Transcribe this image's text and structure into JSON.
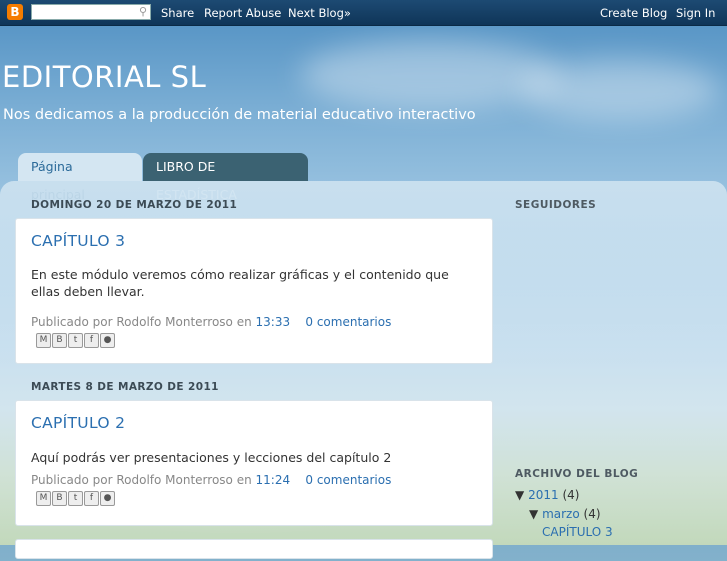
{
  "navbar": {
    "logo": "B",
    "search_placeholder": "",
    "links": {
      "share": "Share",
      "report_abuse": "Report Abuse",
      "next_blog": "Next Blog»",
      "create_blog": "Create Blog",
      "sign_in": "Sign In"
    }
  },
  "header": {
    "title": "EDITORIAL SL",
    "description": "Nos dedicamos a la producción de material educativo interactivo"
  },
  "tabs": [
    {
      "label": "Página principal"
    },
    {
      "label": "LIBRO DE ESTADÍSTICA"
    }
  ],
  "posts": [
    {
      "date": "DOMINGO 20 DE MARZO DE 2011",
      "title": "CAPÍTULO 3",
      "body": "En este módulo veremos cómo realizar gráficas y el contenido que ellas deben llevar.",
      "footer_prefix": "Publicado por Rodolfo Monterroso en",
      "time": "13:33",
      "comments": "0 comentarios"
    },
    {
      "date": "MARTES 8 DE MARZO DE 2011",
      "title": "CAPÍTULO 2",
      "body": "Aquí podrás ver presentaciones y lecciones del capítulo 2",
      "footer_prefix": "Publicado por Rodolfo Monterroso en",
      "time": "11:24",
      "comments": "0 comentarios"
    }
  ],
  "share_icons": [
    "email-icon",
    "blogthis-icon",
    "twitter-icon",
    "facebook-icon",
    "buzz-icon"
  ],
  "sidebar": {
    "followers_title": "SEGUIDORES",
    "archive_title": "ARCHIVO DEL BLOG",
    "archive": {
      "year": "2011",
      "year_count": "(4)",
      "month": "marzo",
      "month_count": "(4)",
      "post": "CAPÍTULO 3"
    }
  },
  "colors": {
    "accent": "#2b6fb0",
    "navbar": "#0f3558",
    "tab_active": "#d4e6f2",
    "tab_inactive": "#3b6272"
  }
}
